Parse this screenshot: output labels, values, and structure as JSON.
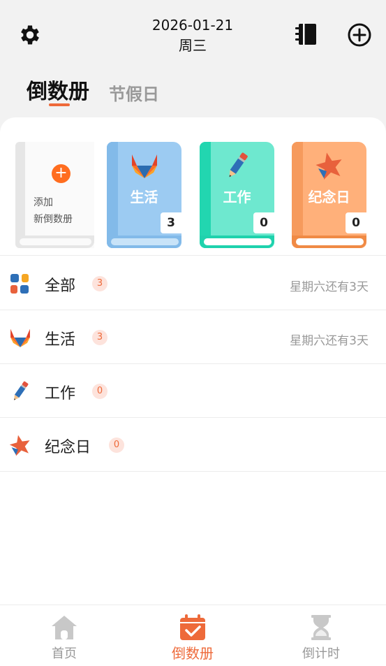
{
  "header": {
    "date": "2026-01-21",
    "weekday": "周三"
  },
  "tabs": [
    {
      "label": "倒数册",
      "active": true
    },
    {
      "label": "节假日",
      "active": false
    }
  ],
  "shelf": {
    "add_label_line1": "添加",
    "add_label_line2": "新倒数册",
    "books": [
      {
        "name": "生活",
        "count": "3",
        "icon": "gitlab-fox-icon",
        "color": "#9ccbf2"
      },
      {
        "name": "工作",
        "count": "0",
        "icon": "pencil-icon",
        "color": "#6ee8cf"
      },
      {
        "name": "纪念日",
        "count": "0",
        "icon": "star-icon",
        "color": "#ffb07a"
      }
    ]
  },
  "list": [
    {
      "label": "全部",
      "count": "3",
      "note": "星期六还有3天",
      "icon": "grid-icon"
    },
    {
      "label": "生活",
      "count": "3",
      "note": "星期六还有3天",
      "icon": "gitlab-fox-icon"
    },
    {
      "label": "工作",
      "count": "0",
      "note": "",
      "icon": "pencil-icon"
    },
    {
      "label": "纪念日",
      "count": "0",
      "note": "",
      "icon": "star-icon"
    }
  ],
  "nav": [
    {
      "label": "首页",
      "icon": "home-icon",
      "active": false
    },
    {
      "label": "倒数册",
      "icon": "calendar-check-icon",
      "active": true
    },
    {
      "label": "倒计时",
      "icon": "hourglass-icon",
      "active": false
    }
  ],
  "colors": {
    "accent": "#ee6a3a",
    "add_orange": "#ff6d1f"
  }
}
